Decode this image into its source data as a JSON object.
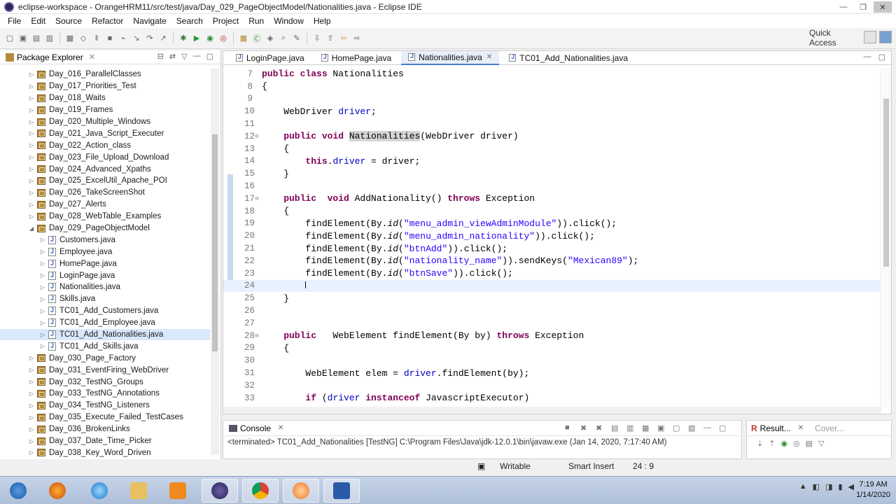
{
  "window": {
    "title": "eclipse-workspace - OrangeHRM11/src/test/java/Day_029_PageObjectModel/Nationalities.java - Eclipse IDE"
  },
  "menu": [
    "File",
    "Edit",
    "Source",
    "Refactor",
    "Navigate",
    "Search",
    "Project",
    "Run",
    "Window",
    "Help"
  ],
  "quick_access": "Quick Access",
  "package_explorer": {
    "title": "Package Explorer",
    "items": [
      {
        "label": "Day_016_ParallelClasses",
        "kind": "package",
        "indent": 0,
        "expanded": false
      },
      {
        "label": "Day_017_Priorities_Test",
        "kind": "package",
        "indent": 0,
        "expanded": false
      },
      {
        "label": "Day_018_Waits",
        "kind": "package",
        "indent": 0,
        "expanded": false
      },
      {
        "label": "Day_019_Frames",
        "kind": "package",
        "indent": 0,
        "expanded": false
      },
      {
        "label": "Day_020_Multiple_Windows",
        "kind": "package",
        "indent": 0,
        "expanded": false
      },
      {
        "label": "Day_021_Java_Script_Executer",
        "kind": "package",
        "indent": 0,
        "expanded": false
      },
      {
        "label": "Day_022_Action_class",
        "kind": "package",
        "indent": 0,
        "expanded": false
      },
      {
        "label": "Day_023_File_Upload_Download",
        "kind": "package",
        "indent": 0,
        "expanded": false
      },
      {
        "label": "Day_024_Advanced_Xpaths",
        "kind": "package",
        "indent": 0,
        "expanded": false
      },
      {
        "label": "Day_025_ExcelUtil_Apache_POI",
        "kind": "package",
        "indent": 0,
        "expanded": false
      },
      {
        "label": "Day_026_TakeScreenShot",
        "kind": "package",
        "indent": 0,
        "expanded": false
      },
      {
        "label": "Day_027_Alerts",
        "kind": "package",
        "indent": 0,
        "expanded": false
      },
      {
        "label": "Day_028_WebTable_Examples",
        "kind": "package",
        "indent": 0,
        "expanded": false
      },
      {
        "label": "Day_029_PageObjectModel",
        "kind": "package",
        "indent": 0,
        "expanded": true
      },
      {
        "label": "Customers.java",
        "kind": "java",
        "indent": 1,
        "expanded": false
      },
      {
        "label": "Employee.java",
        "kind": "java",
        "indent": 1,
        "expanded": false
      },
      {
        "label": "HomePage.java",
        "kind": "java",
        "indent": 1,
        "expanded": false
      },
      {
        "label": "LoginPage.java",
        "kind": "java",
        "indent": 1,
        "expanded": false
      },
      {
        "label": "Nationalities.java",
        "kind": "java",
        "indent": 1,
        "expanded": false
      },
      {
        "label": "Skills.java",
        "kind": "java",
        "indent": 1,
        "expanded": false
      },
      {
        "label": "TC01_Add_Customers.java",
        "kind": "java",
        "indent": 1,
        "expanded": false
      },
      {
        "label": "TC01_Add_Employee.java",
        "kind": "java",
        "indent": 1,
        "expanded": false
      },
      {
        "label": "TC01_Add_Nationalities.java",
        "kind": "java",
        "indent": 1,
        "expanded": false,
        "selected": true
      },
      {
        "label": "TC01_Add_Skills.java",
        "kind": "java",
        "indent": 1,
        "expanded": false
      },
      {
        "label": "Day_030_Page_Factory",
        "kind": "package",
        "indent": 0,
        "expanded": false
      },
      {
        "label": "Day_031_EventFiring_WebDriver",
        "kind": "package",
        "indent": 0,
        "expanded": false
      },
      {
        "label": "Day_032_TestNG_Groups",
        "kind": "package",
        "indent": 0,
        "expanded": false
      },
      {
        "label": "Day_033_TestNG_Annotations",
        "kind": "package",
        "indent": 0,
        "expanded": false
      },
      {
        "label": "Day_034_TestNG_Listeners",
        "kind": "package",
        "indent": 0,
        "expanded": false
      },
      {
        "label": "Day_035_Execute_Failed_TestCases",
        "kind": "package",
        "indent": 0,
        "expanded": false
      },
      {
        "label": "Day_036_BrokenLinks",
        "kind": "package",
        "indent": 0,
        "expanded": false
      },
      {
        "label": "Day_037_Date_Time_Picker",
        "kind": "package",
        "indent": 0,
        "expanded": false
      },
      {
        "label": "Day_038_Key_Word_Driven",
        "kind": "package",
        "indent": 0,
        "expanded": false
      }
    ]
  },
  "editor": {
    "tabs": [
      {
        "label": "LoginPage.java",
        "active": false
      },
      {
        "label": "HomePage.java",
        "active": false
      },
      {
        "label": "Nationalities.java",
        "active": true
      },
      {
        "label": "TC01_Add_Nationalities.java",
        "active": false
      }
    ],
    "lines": [
      {
        "n": "7",
        "fold": "",
        "tokens": [
          [
            "kw",
            "public class "
          ],
          [
            "",
            "Nationalities"
          ]
        ]
      },
      {
        "n": "8",
        "fold": "",
        "tokens": [
          [
            "",
            "{"
          ]
        ]
      },
      {
        "n": "9",
        "fold": "",
        "tokens": []
      },
      {
        "n": "10",
        "fold": "",
        "tokens": [
          [
            "",
            "    WebDriver "
          ],
          [
            "fld",
            "driver"
          ],
          [
            "",
            ";"
          ]
        ]
      },
      {
        "n": "11",
        "fold": "",
        "tokens": []
      },
      {
        "n": "12",
        "fold": "⊖",
        "tokens": [
          [
            "kw",
            "    public void "
          ],
          [
            "hl",
            "Nationalities"
          ],
          [
            "",
            "(WebDriver driver)"
          ]
        ]
      },
      {
        "n": "13",
        "fold": "",
        "tokens": [
          [
            "",
            "    {"
          ]
        ]
      },
      {
        "n": "14",
        "fold": "",
        "tokens": [
          [
            "kw",
            "        this"
          ],
          [
            "",
            "."
          ],
          [
            "fld",
            "driver"
          ],
          [
            "",
            " = driver;"
          ]
        ]
      },
      {
        "n": "15",
        "fold": "",
        "tokens": [
          [
            "",
            "    }"
          ]
        ]
      },
      {
        "n": "16",
        "fold": "",
        "tokens": []
      },
      {
        "n": "17",
        "fold": "⊖",
        "tokens": [
          [
            "kw",
            "    public  void "
          ],
          [
            "",
            "AddNationality() "
          ],
          [
            "kw",
            "throws "
          ],
          [
            "",
            "Exception"
          ]
        ]
      },
      {
        "n": "18",
        "fold": "",
        "tokens": [
          [
            "",
            "    {"
          ]
        ]
      },
      {
        "n": "19",
        "fold": "",
        "tokens": [
          [
            "",
            "        findElement(By."
          ],
          [
            "it",
            "id"
          ],
          [
            "",
            "("
          ],
          [
            "str",
            "\"menu_admin_viewAdminModule\""
          ],
          [
            "",
            "))."
          ],
          [
            "",
            "click();"
          ]
        ]
      },
      {
        "n": "20",
        "fold": "",
        "tokens": [
          [
            "",
            "        findElement(By."
          ],
          [
            "it",
            "id"
          ],
          [
            "",
            "("
          ],
          [
            "str",
            "\"menu_admin_nationality\""
          ],
          [
            "",
            "))."
          ],
          [
            "",
            "click();"
          ]
        ]
      },
      {
        "n": "21",
        "fold": "",
        "tokens": [
          [
            "",
            "        findElement(By."
          ],
          [
            "it",
            "id"
          ],
          [
            "",
            "("
          ],
          [
            "str",
            "\"btnAdd\""
          ],
          [
            "",
            "))."
          ],
          [
            "",
            "click();"
          ]
        ]
      },
      {
        "n": "22",
        "fold": "",
        "tokens": [
          [
            "",
            "        findElement(By."
          ],
          [
            "it",
            "id"
          ],
          [
            "",
            "("
          ],
          [
            "str",
            "\"nationality_name\""
          ],
          [
            "",
            "))."
          ],
          [
            "",
            "sendKeys("
          ],
          [
            "str",
            "\"Mexican89\""
          ],
          [
            "",
            ");"
          ]
        ]
      },
      {
        "n": "23",
        "fold": "",
        "tokens": [
          [
            "",
            "        findElement(By."
          ],
          [
            "it",
            "id"
          ],
          [
            "",
            "("
          ],
          [
            "str",
            "\"btnSave\""
          ],
          [
            "",
            "))."
          ],
          [
            "",
            "click();"
          ]
        ]
      },
      {
        "n": "24",
        "fold": "",
        "tokens": [
          [
            "",
            "        "
          ],
          [
            "cursor",
            ""
          ]
        ],
        "current": true
      },
      {
        "n": "25",
        "fold": "",
        "tokens": [
          [
            "",
            "    }"
          ]
        ]
      },
      {
        "n": "26",
        "fold": "",
        "tokens": []
      },
      {
        "n": "27",
        "fold": "",
        "tokens": []
      },
      {
        "n": "28",
        "fold": "⊖",
        "tokens": [
          [
            "kw",
            "    public   "
          ],
          [
            "",
            "WebElement findElement(By by) "
          ],
          [
            "kw",
            "throws "
          ],
          [
            "",
            "Exception"
          ]
        ]
      },
      {
        "n": "29",
        "fold": "",
        "tokens": [
          [
            "",
            "    {"
          ]
        ]
      },
      {
        "n": "30",
        "fold": "",
        "tokens": []
      },
      {
        "n": "31",
        "fold": "",
        "tokens": [
          [
            "",
            "        WebElement elem = "
          ],
          [
            "fld",
            "driver"
          ],
          [
            "",
            ".findElement(by);"
          ]
        ]
      },
      {
        "n": "32",
        "fold": "",
        "tokens": []
      },
      {
        "n": "33",
        "fold": "",
        "tokens": [
          [
            "kw",
            "        if "
          ],
          [
            "",
            "("
          ],
          [
            "fld",
            "driver "
          ],
          [
            "kw",
            "instanceof "
          ],
          [
            "",
            "JavascriptExecutor)"
          ]
        ]
      }
    ]
  },
  "console": {
    "title": "Console",
    "message": "<terminated> TC01_Add_Nationalities [TestNG] C:\\Program Files\\Java\\jdk-12.0.1\\bin\\javaw.exe (Jan 14, 2020, 7:17:40 AM)"
  },
  "results": {
    "title": "Result...",
    "coverage": "Cover..."
  },
  "status": {
    "mode": "Writable",
    "insert": "Smart Insert",
    "position": "24 : 9"
  },
  "clock": {
    "time": "7:19 AM",
    "date": "1/14/2020"
  },
  "colors": {
    "keyword": "#7f0055",
    "string": "#2a00ff",
    "field": "#0000c0",
    "current_line": "#e8f2fe"
  }
}
